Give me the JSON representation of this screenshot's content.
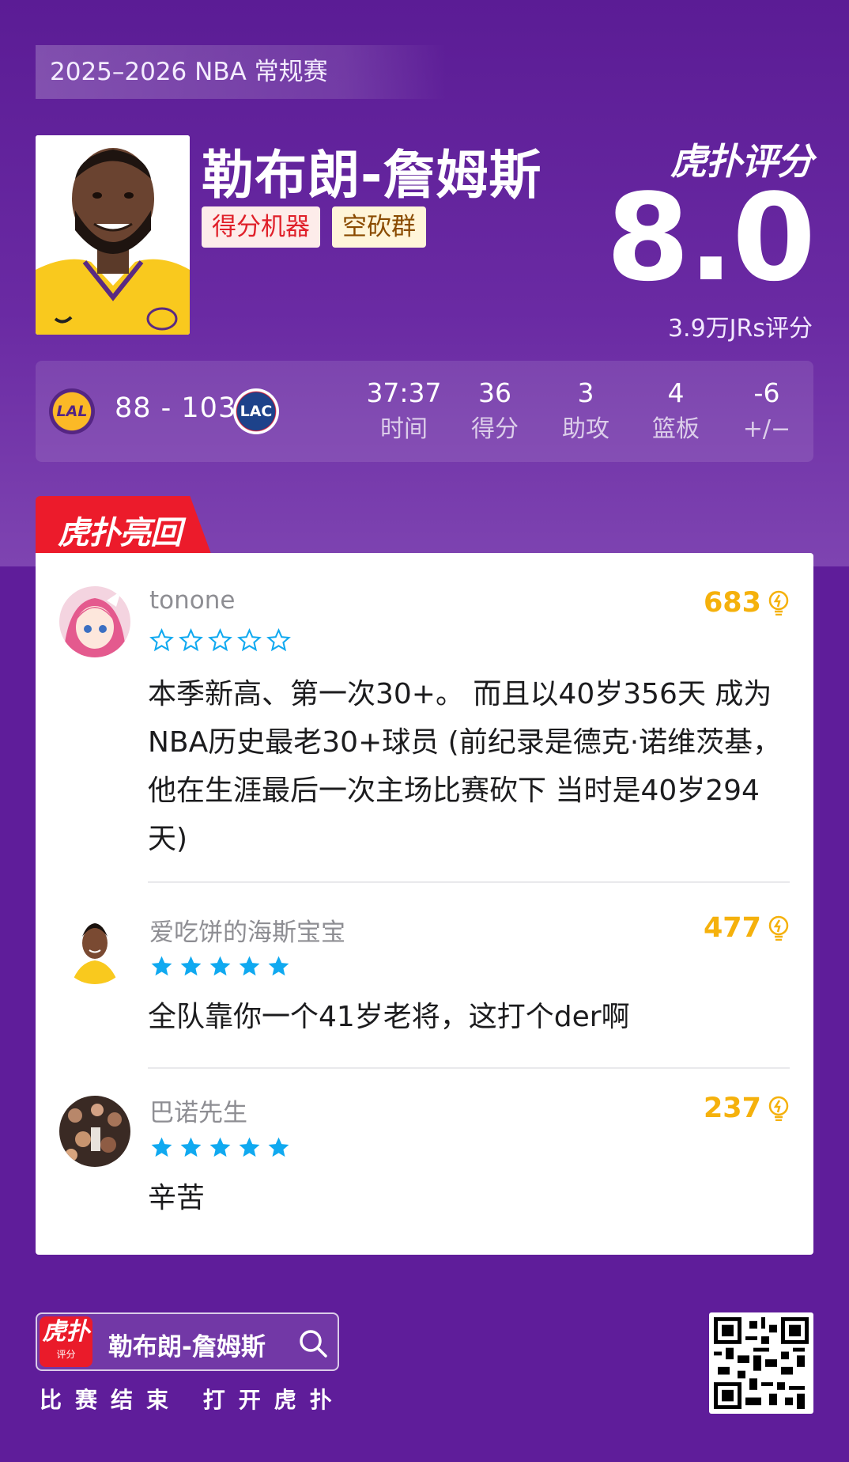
{
  "season": "2025–2026 NBA 常规赛",
  "player": {
    "name": "勒布朗-詹姆斯",
    "tags": [
      "得分机器",
      "空砍群"
    ]
  },
  "rating": {
    "brand": "虎扑评分",
    "score": "8.0",
    "count": "3.9万JRs评分"
  },
  "game": {
    "home_team": "LAL",
    "away_team": "LAC",
    "score": "88 - 103",
    "stats": [
      {
        "value": "37:37",
        "label": "时间"
      },
      {
        "value": "36",
        "label": "得分"
      },
      {
        "value": "3",
        "label": "助攻"
      },
      {
        "value": "4",
        "label": "篮板"
      },
      {
        "value": "-6",
        "label": "+/−"
      }
    ]
  },
  "section_title": "虎扑亮回复",
  "comments": [
    {
      "user": "tonone",
      "likes": "683",
      "stars": 0,
      "text": "本季新高、第一次30+。 而且以40岁356天 成为NBA历史最老30+球员 (前纪录是德克·诺维茨基，他在生涯最后一次主场比赛砍下 当时是40岁294天)"
    },
    {
      "user": "爱吃饼的海斯宝宝",
      "likes": "477",
      "stars": 5,
      "text": "全队靠你一个41岁老将，这打个der啊"
    },
    {
      "user": "巴诺先生",
      "likes": "237",
      "stars": 5,
      "text": "辛苦"
    }
  ],
  "footer": {
    "app_icon_main": "虎扑",
    "app_icon_sub": "评分",
    "search_text": "勒布朗-詹姆斯",
    "caption": "比赛结束 打开虎扑"
  },
  "colors": {
    "background": "#5f1d9a",
    "accent_red": "#ec1b2b",
    "likes": "#f5b10c",
    "star": "#10a9f0"
  },
  "icons": [
    "search-icon",
    "like-icon",
    "star-icon",
    "qr-code"
  ]
}
